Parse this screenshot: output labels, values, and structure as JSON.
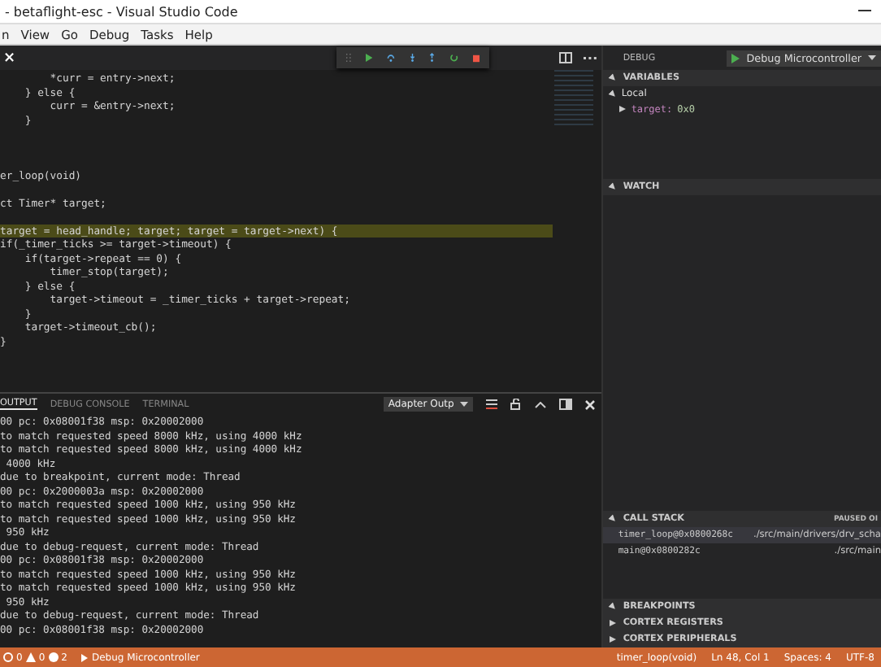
{
  "window": {
    "title": "- betaflight-esc - Visual Studio Code"
  },
  "menu": [
    "n",
    "View",
    "Go",
    "Debug",
    "Tasks",
    "Help"
  ],
  "editor": {
    "close": "×",
    "lines": [
      {
        "text": "        *curr = entry->next;",
        "highlighted": false
      },
      {
        "text": "    } else {",
        "highlighted": false
      },
      {
        "text": "        curr = &entry->next;",
        "highlighted": false
      },
      {
        "text": "    }",
        "highlighted": false
      },
      {
        "highlighted": false
      },
      {
        "highlighted": false
      },
      {
        "highlighted": false
      },
      {
        "text": "er_loop(void)",
        "highlighted": false
      },
      {
        "highlighted": false
      },
      {
        "text": "ct Timer* target;",
        "highlighted": false
      },
      {
        "highlighted": false
      },
      {
        "text": "target = head_handle; target; target = target->next) {",
        "highlighted": true
      },
      {
        "text": "if(_timer_ticks >= target->timeout) {",
        "highlighted": false
      },
      {
        "text": "    if(target->repeat == 0) {",
        "highlighted": false
      },
      {
        "text": "        timer_stop(target);",
        "highlighted": false
      },
      {
        "text": "    } else {",
        "highlighted": false
      },
      {
        "text": "        target->timeout = _timer_ticks + target->repeat;",
        "highlighted": false
      },
      {
        "text": "    }",
        "highlighted": false
      },
      {
        "text": "    target->timeout_cb();",
        "highlighted": false
      },
      {
        "text": "}",
        "highlighted": false
      }
    ]
  },
  "panel": {
    "tabs": [
      {
        "label": "OUTPUT",
        "selected": true
      },
      {
        "label": "DEBUG CONSOLE",
        "selected": false
      },
      {
        "label": "TERMINAL",
        "selected": false
      }
    ],
    "channel": "Adapter Outp",
    "lines": [
      "00 pc: 0x08001f38 msp: 0x20002000",
      "to match requested speed 8000 kHz, using 4000 kHz",
      "to match requested speed 8000 kHz, using 4000 kHz",
      " 4000 kHz",
      "due to breakpoint, current mode: Thread",
      "00 pc: 0x2000003a msp: 0x20002000",
      "to match requested speed 1000 kHz, using 950 kHz",
      "to match requested speed 1000 kHz, using 950 kHz",
      " 950 kHz",
      "due to debug-request, current mode: Thread",
      "00 pc: 0x08001f38 msp: 0x20002000",
      "to match requested speed 1000 kHz, using 950 kHz",
      "to match requested speed 1000 kHz, using 950 kHz",
      " 950 kHz",
      "due to debug-request, current mode: Thread",
      "00 pc: 0x08001f38 msp: 0x20002000"
    ]
  },
  "debug": {
    "title": "DEBUG",
    "configuration": "Debug Microcontroller",
    "variables": {
      "title": "VARIABLES",
      "expanded": true,
      "scopes": [
        {
          "name": "Local",
          "expanded": true,
          "children": [
            {
              "name": "target:",
              "value": "0x0",
              "expanded": false
            }
          ]
        }
      ]
    },
    "watch": {
      "title": "WATCH",
      "expanded": true
    },
    "call_stack": {
      "title": "CALL STACK",
      "expanded": true,
      "status": "PAUSED OI",
      "frames": [
        {
          "name": "timer_loop@0x0800268c",
          "path": "./src/main/drivers/drv_scha",
          "selected": true
        },
        {
          "name": "main@0x0800282c",
          "path": "./src/main",
          "selected": false
        }
      ]
    },
    "sections": [
      {
        "title": "BREAKPOINTS",
        "expanded": true
      },
      {
        "title": "CORTEX REGISTERS",
        "expanded": false
      },
      {
        "title": "CORTEX PERIPHERALS",
        "expanded": false
      }
    ]
  },
  "status_bar": {
    "errors": "0",
    "warnings": "0",
    "infos": "2",
    "launch": "Debug Microcontroller",
    "function": "timer_loop(void)",
    "position": "Ln 48, Col 1",
    "spaces": "Spaces: 4",
    "encoding": "UTF-8"
  }
}
